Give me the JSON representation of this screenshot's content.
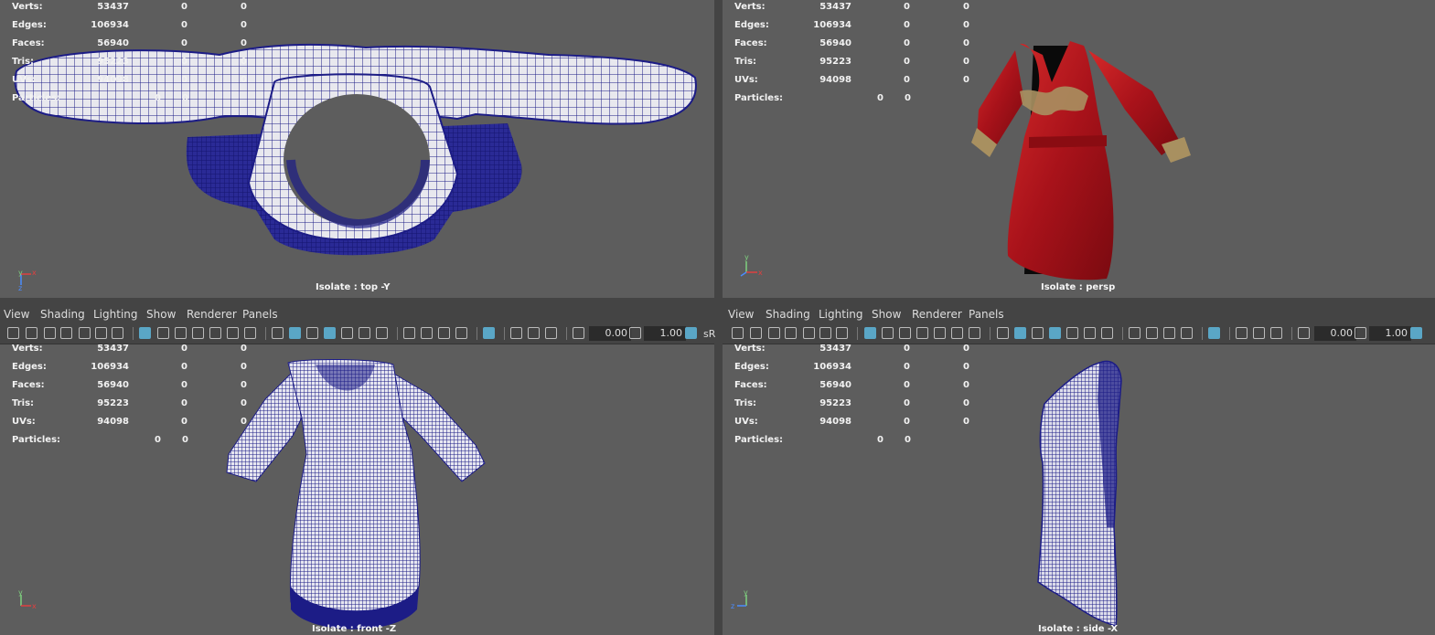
{
  "stats": {
    "rows": [
      {
        "label": "Verts:",
        "v1": "53437",
        "v2": "0",
        "v3": "0"
      },
      {
        "label": "Edges:",
        "v1": "106934",
        "v2": "0",
        "v3": "0"
      },
      {
        "label": "Faces:",
        "v1": "56940",
        "v2": "0",
        "v3": "0"
      },
      {
        "label": "Tris:",
        "v1": "95223",
        "v2": "0",
        "v3": "0"
      },
      {
        "label": "UVs:",
        "v1": "94098",
        "v2": "0",
        "v3": "0"
      }
    ],
    "particles": {
      "label": "Particles:",
      "v1": "0",
      "v2": "0"
    }
  },
  "panels": {
    "top_left": {
      "camera": "Isolate : top -Y"
    },
    "top_right": {
      "camera": "Isolate : persp"
    },
    "bottom_left": {
      "camera": "Isolate : front -Z"
    },
    "bottom_right": {
      "camera": "Isolate : side -X"
    }
  },
  "menu": {
    "view": "View",
    "shading": "Shading",
    "lighting": "Lighting",
    "show": "Show",
    "renderer": "Renderer",
    "panels": "Panels"
  },
  "toolbar": {
    "exposure_value": "0.00",
    "gamma_value": "1.00",
    "colorspace_label": "sR"
  },
  "axis": {
    "x": "x",
    "y": "y",
    "z": "z"
  },
  "colors": {
    "viewport_bg": "#5d5d5d",
    "wireframe": "#1c1c86",
    "dress_red": "#b8161a",
    "lace_gold": "#a89060",
    "active_icon": "#5aa6c6"
  },
  "icons": [
    "camera-icon",
    "grid-icon",
    "wireframe-icon",
    "smooth-shade-icon",
    "textured-icon",
    "light-icon",
    "isolate-icon",
    "xray-icon",
    "exposure-icon",
    "gamma-icon"
  ]
}
